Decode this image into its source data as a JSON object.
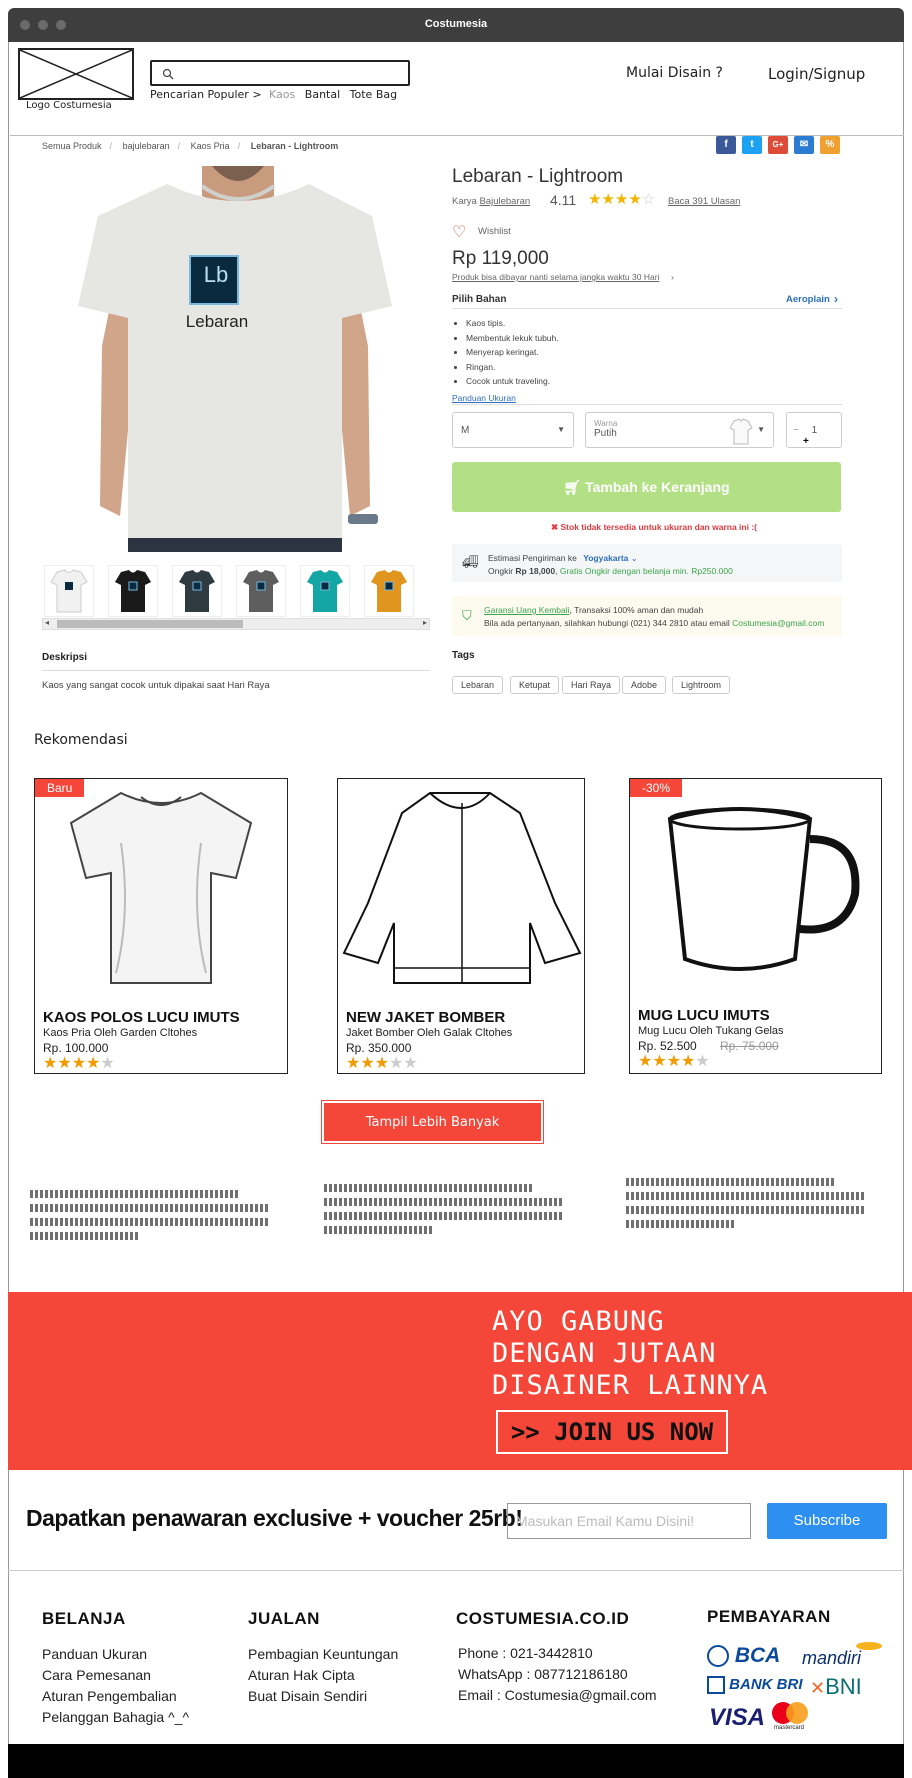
{
  "window": {
    "title": "Costumesia"
  },
  "header": {
    "logo_label": "Logo Costumesia",
    "search_placeholder": "",
    "popular_label": "Pencarian Populer >",
    "popular_items": [
      "Kaos",
      "Bantal",
      "Tote Bag"
    ],
    "nav_design": "Mulai Disain ?",
    "nav_login": "Login/Signup"
  },
  "breadcrumb": [
    "Semua Produk",
    "bajulebaran",
    "Kaos Pria",
    "Lebaran - Lightroom"
  ],
  "social": [
    {
      "icon": "facebook-icon",
      "glyph": "f",
      "color": "#3b5998"
    },
    {
      "icon": "twitter-icon",
      "glyph": "t",
      "color": "#1da1f2"
    },
    {
      "icon": "google-plus-icon",
      "glyph": "G+",
      "color": "#dd4b39"
    },
    {
      "icon": "email-icon",
      "glyph": "✉",
      "color": "#2a7bd1"
    },
    {
      "icon": "link-icon",
      "glyph": "%",
      "color": "#f0a030"
    }
  ],
  "product": {
    "title": "Lebaran - Lightroom",
    "by_label": "Karya",
    "by_name": "Bajulebaran",
    "rating": "4.11",
    "stars": 4,
    "reviews": "Baca 391 Ulasan",
    "wishlist": "Wishlist",
    "price": "Rp 119,000",
    "pay_later": "Produk bisa dibayar nanti selama jangka waktu 30 Hari",
    "material_label": "Pilih Bahan",
    "material_value": "Aeroplain",
    "features": [
      "Kaos tipis.",
      "Membentuk lekuk tubuh.",
      "Menyerap keringat.",
      "Ringan.",
      "Cocok untuk traveling."
    ],
    "size_guide": "Panduan Ukuran",
    "size": "M",
    "color_label": "Warna",
    "color_value": "Putih",
    "qty": "1",
    "add_to_cart": "Tambah ke Keranjang",
    "stock_warning": "Stok tidak tersedia untuk ukuran dan warna ini :(",
    "shipping_label": "Estimasi Pengiriman ke",
    "shipping_city": "Yogyakarta",
    "shipping_cost_label": "Ongkir",
    "shipping_cost": "Rp 18,000",
    "shipping_free": "Gratis Ongkir dengan belanja min. Rp250.000",
    "guarantee_link": "Garansi Uang Kembali",
    "guarantee_text": ", Transaksi 100% aman dan mudah",
    "contact_text": "Bila ada pertanyaan, silahkan hubungi (021) 344 2810 atau email",
    "contact_email": "Costumesia@gmail.com",
    "shirt_print": "Lebaran",
    "shirt_logo": "Lb",
    "description_title": "Deskripsi",
    "description": "Kaos yang sangat cocok untuk dipakai saat Hari Raya",
    "tags_title": "Tags",
    "tags": [
      "Lebaran",
      "Ketupat",
      "Hari Raya",
      "Adobe",
      "Lightroom"
    ],
    "thumb_colors": [
      "#f1f1f1",
      "#1a1a1a",
      "#2f3b40",
      "#5e5e5e",
      "#14a5a5",
      "#e0961e"
    ]
  },
  "recommend": {
    "title": "Rekomendasi",
    "items": [
      {
        "badge": "Baru",
        "title": "KAOS POLOS LUCU IMUTS",
        "sub": "Kaos Pria Oleh Garden Cltohes",
        "price": "Rp. 100.000",
        "old_price": "",
        "stars": 4
      },
      {
        "badge": "",
        "title": "NEW JAKET BOMBER",
        "sub": "Jaket Bomber Oleh Galak Cltohes",
        "price": "Rp. 350.000",
        "old_price": "",
        "stars": 3
      },
      {
        "badge": "-30%",
        "title": "MUG LUCU IMUTS",
        "sub": "Mug Lucu Oleh Tukang Gelas",
        "price": "Rp. 52.500",
        "old_price": "Rp. 75.000",
        "stars": 4
      }
    ],
    "show_more": "Tampil Lebih Banyak"
  },
  "banner": {
    "line1": "AYO GABUNG",
    "line2": "DENGAN JUTAAN",
    "line3": "DISAINER LAINNYA",
    "cta": ">> JOIN US NOW"
  },
  "newsletter": {
    "title": "Dapatkan penawaran exclusive + voucher 25rb!",
    "placeholder": "Masukan Email Kamu Disini!",
    "button": "Subscribe"
  },
  "footer": {
    "col1": {
      "title": "BELANJA",
      "links": [
        "Panduan Ukuran",
        "Cara Pemesanan",
        "Aturan Pengembalian",
        "Pelanggan Bahagia ^_^"
      ]
    },
    "col2": {
      "title": "JUALAN",
      "links": [
        "Pembagian Keuntungan",
        "Aturan Hak Cipta",
        "Buat Disain Sendiri"
      ]
    },
    "col3": {
      "title": "COSTUMESIA.CO.ID",
      "lines": [
        "Phone : 021-3442810",
        "WhatsApp : 087712186180",
        "Email : Costumesia@gmail.com"
      ]
    },
    "col4": {
      "title": "PEMBAYARAN",
      "banks": [
        "BCA",
        "mandiri",
        "BANK BRI",
        "BNI",
        "VISA",
        "mastercard"
      ]
    }
  }
}
